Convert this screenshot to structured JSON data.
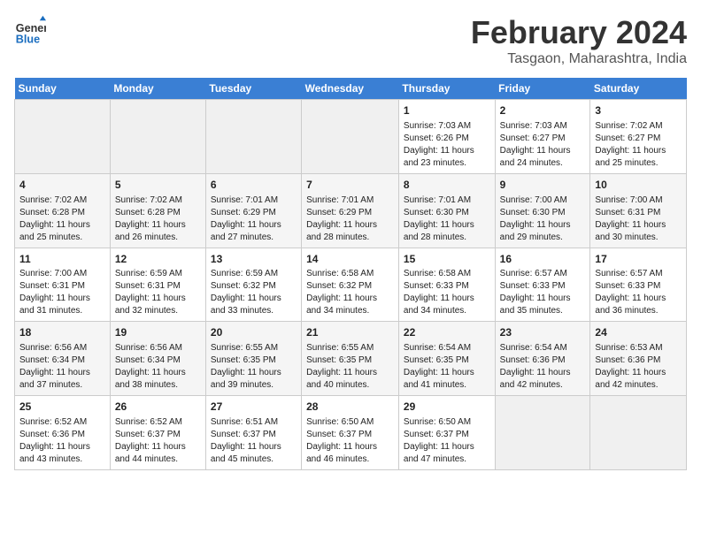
{
  "header": {
    "logo_line1": "General",
    "logo_line2": "Blue",
    "month_title": "February 2024",
    "subtitle": "Tasgaon, Maharashtra, India"
  },
  "days_of_week": [
    "Sunday",
    "Monday",
    "Tuesday",
    "Wednesday",
    "Thursday",
    "Friday",
    "Saturday"
  ],
  "weeks": [
    [
      {
        "day": "",
        "empty": true
      },
      {
        "day": "",
        "empty": true
      },
      {
        "day": "",
        "empty": true
      },
      {
        "day": "",
        "empty": true
      },
      {
        "day": "1",
        "sunrise": "7:03 AM",
        "sunset": "6:26 PM",
        "daylight": "11 hours and 23 minutes."
      },
      {
        "day": "2",
        "sunrise": "7:03 AM",
        "sunset": "6:27 PM",
        "daylight": "11 hours and 24 minutes."
      },
      {
        "day": "3",
        "sunrise": "7:02 AM",
        "sunset": "6:27 PM",
        "daylight": "11 hours and 25 minutes."
      }
    ],
    [
      {
        "day": "4",
        "sunrise": "7:02 AM",
        "sunset": "6:28 PM",
        "daylight": "11 hours and 25 minutes."
      },
      {
        "day": "5",
        "sunrise": "7:02 AM",
        "sunset": "6:28 PM",
        "daylight": "11 hours and 26 minutes."
      },
      {
        "day": "6",
        "sunrise": "7:01 AM",
        "sunset": "6:29 PM",
        "daylight": "11 hours and 27 minutes."
      },
      {
        "day": "7",
        "sunrise": "7:01 AM",
        "sunset": "6:29 PM",
        "daylight": "11 hours and 28 minutes."
      },
      {
        "day": "8",
        "sunrise": "7:01 AM",
        "sunset": "6:30 PM",
        "daylight": "11 hours and 28 minutes."
      },
      {
        "day": "9",
        "sunrise": "7:00 AM",
        "sunset": "6:30 PM",
        "daylight": "11 hours and 29 minutes."
      },
      {
        "day": "10",
        "sunrise": "7:00 AM",
        "sunset": "6:31 PM",
        "daylight": "11 hours and 30 minutes."
      }
    ],
    [
      {
        "day": "11",
        "sunrise": "7:00 AM",
        "sunset": "6:31 PM",
        "daylight": "11 hours and 31 minutes."
      },
      {
        "day": "12",
        "sunrise": "6:59 AM",
        "sunset": "6:31 PM",
        "daylight": "11 hours and 32 minutes."
      },
      {
        "day": "13",
        "sunrise": "6:59 AM",
        "sunset": "6:32 PM",
        "daylight": "11 hours and 33 minutes."
      },
      {
        "day": "14",
        "sunrise": "6:58 AM",
        "sunset": "6:32 PM",
        "daylight": "11 hours and 34 minutes."
      },
      {
        "day": "15",
        "sunrise": "6:58 AM",
        "sunset": "6:33 PM",
        "daylight": "11 hours and 34 minutes."
      },
      {
        "day": "16",
        "sunrise": "6:57 AM",
        "sunset": "6:33 PM",
        "daylight": "11 hours and 35 minutes."
      },
      {
        "day": "17",
        "sunrise": "6:57 AM",
        "sunset": "6:33 PM",
        "daylight": "11 hours and 36 minutes."
      }
    ],
    [
      {
        "day": "18",
        "sunrise": "6:56 AM",
        "sunset": "6:34 PM",
        "daylight": "11 hours and 37 minutes."
      },
      {
        "day": "19",
        "sunrise": "6:56 AM",
        "sunset": "6:34 PM",
        "daylight": "11 hours and 38 minutes."
      },
      {
        "day": "20",
        "sunrise": "6:55 AM",
        "sunset": "6:35 PM",
        "daylight": "11 hours and 39 minutes."
      },
      {
        "day": "21",
        "sunrise": "6:55 AM",
        "sunset": "6:35 PM",
        "daylight": "11 hours and 40 minutes."
      },
      {
        "day": "22",
        "sunrise": "6:54 AM",
        "sunset": "6:35 PM",
        "daylight": "11 hours and 41 minutes."
      },
      {
        "day": "23",
        "sunrise": "6:54 AM",
        "sunset": "6:36 PM",
        "daylight": "11 hours and 42 minutes."
      },
      {
        "day": "24",
        "sunrise": "6:53 AM",
        "sunset": "6:36 PM",
        "daylight": "11 hours and 42 minutes."
      }
    ],
    [
      {
        "day": "25",
        "sunrise": "6:52 AM",
        "sunset": "6:36 PM",
        "daylight": "11 hours and 43 minutes."
      },
      {
        "day": "26",
        "sunrise": "6:52 AM",
        "sunset": "6:37 PM",
        "daylight": "11 hours and 44 minutes."
      },
      {
        "day": "27",
        "sunrise": "6:51 AM",
        "sunset": "6:37 PM",
        "daylight": "11 hours and 45 minutes."
      },
      {
        "day": "28",
        "sunrise": "6:50 AM",
        "sunset": "6:37 PM",
        "daylight": "11 hours and 46 minutes."
      },
      {
        "day": "29",
        "sunrise": "6:50 AM",
        "sunset": "6:37 PM",
        "daylight": "11 hours and 47 minutes."
      },
      {
        "day": "",
        "empty": true
      },
      {
        "day": "",
        "empty": true
      }
    ]
  ]
}
